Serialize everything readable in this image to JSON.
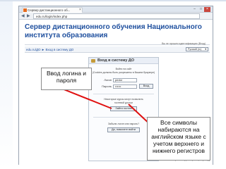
{
  "browser": {
    "tab_title": "Сервер дистанционного об...",
    "tab_close": "×",
    "url": "edu.ru/login/index.php",
    "back": "◀",
    "forward": "▶",
    "window_controls": [
      "–",
      "□",
      "×"
    ]
  },
  "page": {
    "site_title": "Сервер дистанционного обучения Национального института образования",
    "login_info": "Вы не прошли идентификацию (Вход)",
    "breadcrumb": "edu.ru/ДО ► Вход в систему ДО",
    "language": "Русский (ru)",
    "language_arrow": "▼",
    "login_box": {
      "title": "Вход в систему ДО",
      "hint_1": "Войти на сайт",
      "hint_2": "(Cookies должны быть разрешены в Вашем браузере)",
      "login_label": "Логин",
      "login_value": "pedor",
      "password_label": "Пароль",
      "password_value": "••••••",
      "login_button": "Вход",
      "guest_1": "Некоторые курсы могут позволить",
      "guest_2": "гостевой доступ",
      "guest_button": "Зайти гостем",
      "forgot_1": "Забыли логин или пароль?",
      "forgot_button": "Да, помогите войти"
    },
    "footer_login_info": "Вы не прошли идентификацию (Вход)"
  },
  "callouts": {
    "left": "Ввод логина и пароля",
    "right": "Все символы набираются на английском языке с учетом верхнего и нижнего регистров"
  },
  "colors": {
    "title": "#1e4f9e",
    "arrow": "#e01010"
  }
}
